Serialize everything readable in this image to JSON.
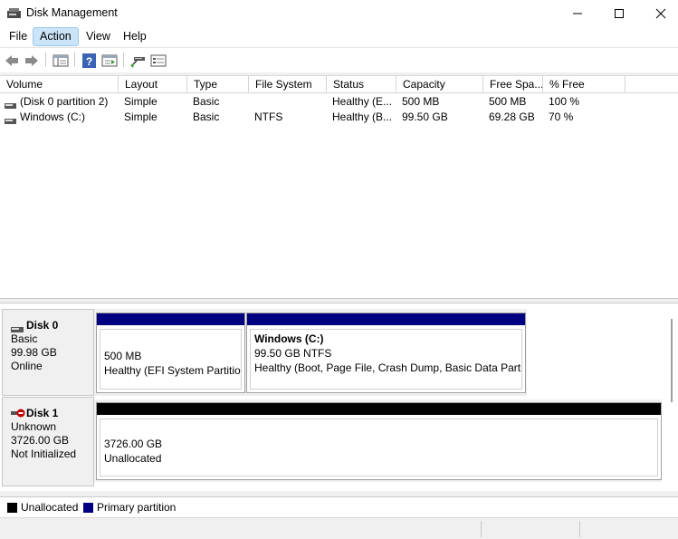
{
  "window": {
    "title": "Disk Management",
    "icon": "disk-management-icon"
  },
  "menu": {
    "items": [
      "File",
      "Action",
      "View",
      "Help"
    ],
    "active": "Action"
  },
  "toolbar": {
    "icons": [
      "back-arrow-icon",
      "forward-arrow-icon",
      "console-tree-icon",
      "help-icon",
      "properties-icon",
      "connect-icon",
      "settings-list-icon"
    ]
  },
  "volume_list": {
    "columns": [
      "Volume",
      "Layout",
      "Type",
      "File System",
      "Status",
      "Capacity",
      "Free Spa...",
      "% Free"
    ],
    "rows": [
      {
        "volume": "(Disk 0 partition 2)",
        "layout": "Simple",
        "type": "Basic",
        "file_system": "",
        "status": "Healthy (E...",
        "capacity": "500 MB",
        "free_space": "500 MB",
        "percent_free": "100 %"
      },
      {
        "volume": "Windows (C:)",
        "layout": "Simple",
        "type": "Basic",
        "file_system": "NTFS",
        "status": "Healthy (B...",
        "capacity": "99.50 GB",
        "free_space": "69.28 GB",
        "percent_free": "70 %"
      }
    ]
  },
  "disks": [
    {
      "name": "Disk 0",
      "type": "Basic",
      "size": "99.98 GB",
      "state": "Online",
      "icon": "disk-icon",
      "partitions": [
        {
          "title": "",
          "line1": "500 MB",
          "line2": "Healthy (EFI System Partition)",
          "kind": "primary"
        },
        {
          "title": "Windows  (C:)",
          "line1": "99.50 GB NTFS",
          "line2": "Healthy (Boot, Page File, Crash Dump, Basic Data Partition)",
          "kind": "primary"
        }
      ]
    },
    {
      "name": "Disk 1",
      "type": "Unknown",
      "size": "3726.00 GB",
      "state": "Not Initialized",
      "icon": "disk-error-icon",
      "partitions": [
        {
          "title": "",
          "line1": "3726.00 GB",
          "line2": "Unallocated",
          "kind": "unallocated"
        }
      ]
    }
  ],
  "legend": [
    {
      "label": "Unallocated",
      "color": "#000000"
    },
    {
      "label": "Primary partition",
      "color": "#000080"
    }
  ],
  "colors": {
    "primary": "#000080",
    "unallocated": "#000000",
    "menu_active": "#cce4f7"
  }
}
